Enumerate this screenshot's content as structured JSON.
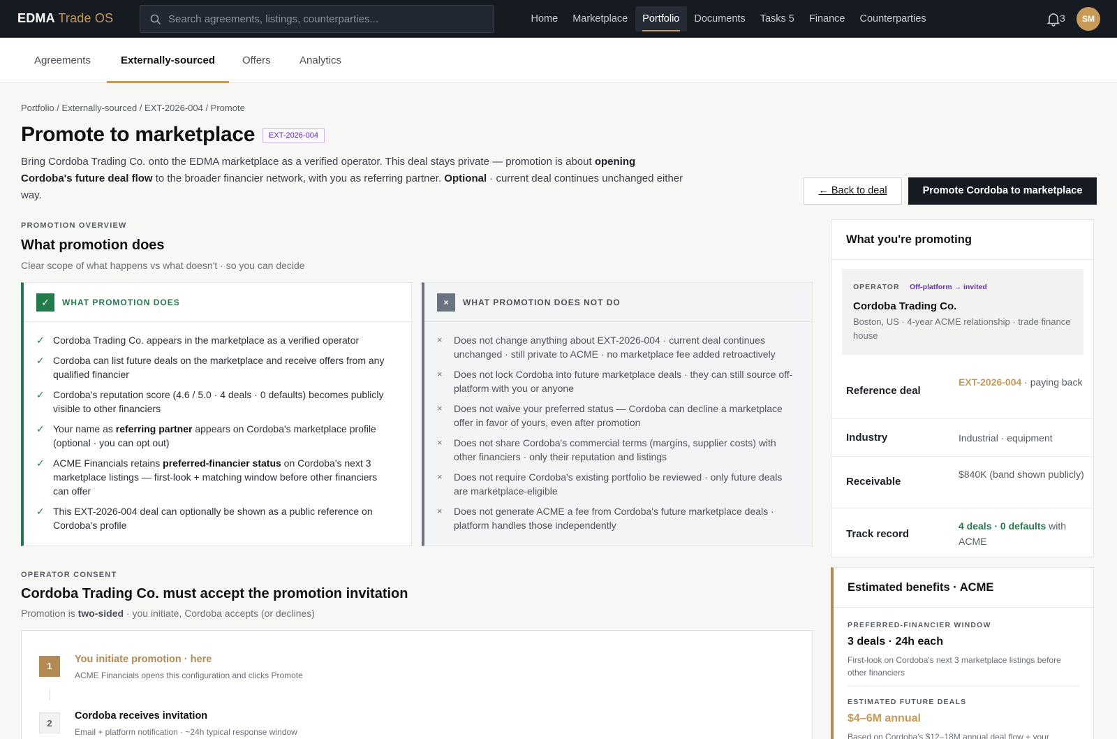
{
  "app": {
    "brand_main": "EDMA",
    "brand_sub": "Trade OS"
  },
  "search": {
    "placeholder": "Search agreements, listings, counterparties..."
  },
  "nav": {
    "home": "Home",
    "marketplace": "Marketplace",
    "portfolio": "Portfolio",
    "documents": "Documents",
    "tasks": "Tasks 5",
    "finance": "Finance",
    "counterparties": "Counterparties"
  },
  "notifications": {
    "count": "3"
  },
  "user": {
    "initials": "SM"
  },
  "subtabs": {
    "agreements": "Agreements",
    "external": "Externally-sourced",
    "offers": "Offers",
    "analytics": "Analytics"
  },
  "breadcrumb": "Portfolio / Externally-sourced / EXT-2026-004 / Promote",
  "page": {
    "title": "Promote to marketplace",
    "tag": "EXT-2026-004",
    "intro_1": "Bring Cordoba Trading Co. onto the EDMA marketplace as a verified operator. This deal stays private — promotion is about ",
    "intro_b1": "opening Cordoba's future deal flow",
    "intro_2": " to the broader financier network, with you as referring partner. ",
    "intro_b2": "Optional",
    "intro_3": " · current deal continues unchanged either way."
  },
  "actions": {
    "back": "← Back to deal",
    "promote": "Promote Cordoba to marketplace"
  },
  "overview": {
    "eyebrow": "PROMOTION OVERVIEW",
    "title": "What promotion does",
    "subtitle": "Clear scope of what happens vs what doesn't · so you can decide",
    "does_label": "WHAT PROMOTION DOES",
    "does": [
      {
        "a": "Cordoba Trading Co. appears in the marketplace as a verified operator",
        "b": "",
        "c": ""
      },
      {
        "a": "Cordoba can list future deals on the marketplace and receive offers from any qualified financier",
        "b": "",
        "c": ""
      },
      {
        "a": "Cordoba's reputation score (4.6 / 5.0 · 4 deals · 0 defaults) becomes publicly visible to other financiers",
        "b": "",
        "c": ""
      },
      {
        "a": "Your name as ",
        "b": "referring partner",
        "c": " appears on Cordoba's marketplace profile (optional · you can opt out)"
      },
      {
        "a": "ACME Financials retains ",
        "b": "preferred-financier status",
        "c": " on Cordoba's next 3 marketplace listings — first-look + matching window before other financiers can offer"
      },
      {
        "a": "This EXT-2026-004 deal can optionally be shown as a public reference on Cordoba's profile",
        "b": "",
        "c": ""
      }
    ],
    "not_label": "WHAT PROMOTION DOES NOT DO",
    "not": [
      "Does not change anything about EXT-2026-004 · current deal continues unchanged · still private to ACME · no marketplace fee added retroactively",
      "Does not lock Cordoba into future marketplace deals · they can still source off-platform with you or anyone",
      "Does not waive your preferred status — Cordoba can decline a marketplace offer in favor of yours, even after promotion",
      "Does not share Cordoba's commercial terms (margins, supplier costs) with other financiers · only their reputation and listings",
      "Does not require Cordoba's existing portfolio be reviewed · only future deals are marketplace-eligible",
      "Does not generate ACME a fee from Cordoba's future marketplace deals · platform handles those independently"
    ]
  },
  "consent": {
    "eyebrow": "OPERATOR CONSENT",
    "title": "Cordoba Trading Co. must accept the promotion invitation",
    "sub_a": "Promotion is ",
    "sub_b": "two-sided",
    "sub_c": " · you initiate, Cordoba accepts (or declines)",
    "steps": [
      {
        "num": "1",
        "title": "You initiate promotion · here",
        "desc": "ACME Financials opens this configuration and clicks Promote"
      },
      {
        "num": "2",
        "title": "Cordoba receives invitation",
        "desc": "Email + platform notification · ~24h typical response window"
      }
    ]
  },
  "side": {
    "title": "What you're promoting",
    "op_label": "OPERATOR",
    "op_status": "Off-platform → invited",
    "op_name": "Cordoba Trading Co.",
    "op_desc": "Boston, US · 4-year ACME relationship · trade finance house",
    "rows": {
      "ref_k": "Reference deal",
      "ref_link": "EXT-2026-004",
      "ref_rest": " · paying back",
      "ind_k": "Industry",
      "ind_v": "Industrial · equipment",
      "rec_k": "Receivable",
      "rec_v": "$840K (band shown publicly)",
      "track_k": "Track record",
      "track_b": "4 deals · 0 defaults",
      "track_rest": " with ACME"
    }
  },
  "benefits": {
    "title": "Estimated benefits · ACME",
    "w_label": "PREFERRED-FINANCIER WINDOW",
    "w_value": "3 deals · 24h each",
    "w_desc": "First-look on Cordoba's next 3 marketplace listings before other financiers",
    "f_label": "ESTIMATED FUTURE DEALS",
    "f_value": "$4–6M annual",
    "f_desc": "Based on Cordoba's $12–18M annual deal flow + your"
  },
  "colors": {
    "accent": "#c79a58",
    "green": "#237a4b",
    "dark": "#161b22",
    "purple": "#5a2ea6"
  }
}
